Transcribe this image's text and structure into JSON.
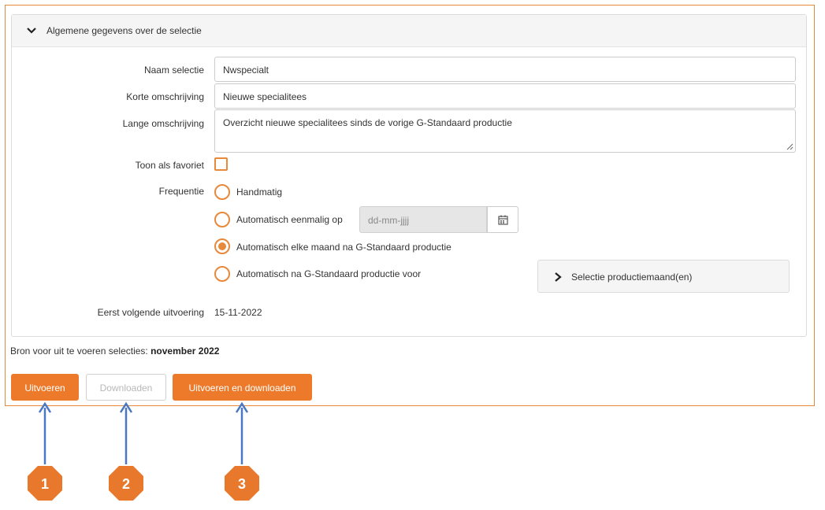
{
  "section": {
    "title": "Algemene gegevens over de selectie"
  },
  "form": {
    "naam_label": "Naam selectie",
    "naam_value": "Nwspecialt",
    "korte_label": "Korte omschrijving",
    "korte_value": "Nieuwe specialitees",
    "lange_label": "Lange omschrijving",
    "lange_value": "Overzicht nieuwe specialitees sinds de vorige G-Standaard productie",
    "favoriet_label": "Toon als favoriet",
    "favoriet_checked": false,
    "frequentie_label": "Frequentie",
    "frequentie_options": [
      {
        "label": "Handmatig",
        "selected": false
      },
      {
        "label": "Automatisch eenmalig op",
        "selected": false
      },
      {
        "label": "Automatisch elke maand na G-Standaard productie",
        "selected": true
      },
      {
        "label": "Automatisch na G-Standaard productie voor",
        "selected": false
      }
    ],
    "date_placeholder": "dd-mm-jjjj",
    "selectie_productiemaand_label": "Selectie productiemaand(en)",
    "eerst_volgende_label": "Eerst volgende uitvoering",
    "eerst_volgende_value": "15-11-2022"
  },
  "bron": {
    "prefix": "Bron voor uit te voeren selecties: ",
    "value": "november 2022"
  },
  "buttons": {
    "uitvoeren": "Uitvoeren",
    "downloaden": "Downloaden",
    "uitvoeren_downloaden": "Uitvoeren en downloaden"
  },
  "callouts": [
    "1",
    "2",
    "3"
  ],
  "colors": {
    "accent": "#ec7a2a",
    "arrow": "#4a78c4",
    "badge": "#e8782c"
  },
  "icons": {
    "section_toggle": "chevron-down-icon",
    "calendar": "calendar-icon",
    "sub_toggle": "chevron-right-icon"
  }
}
